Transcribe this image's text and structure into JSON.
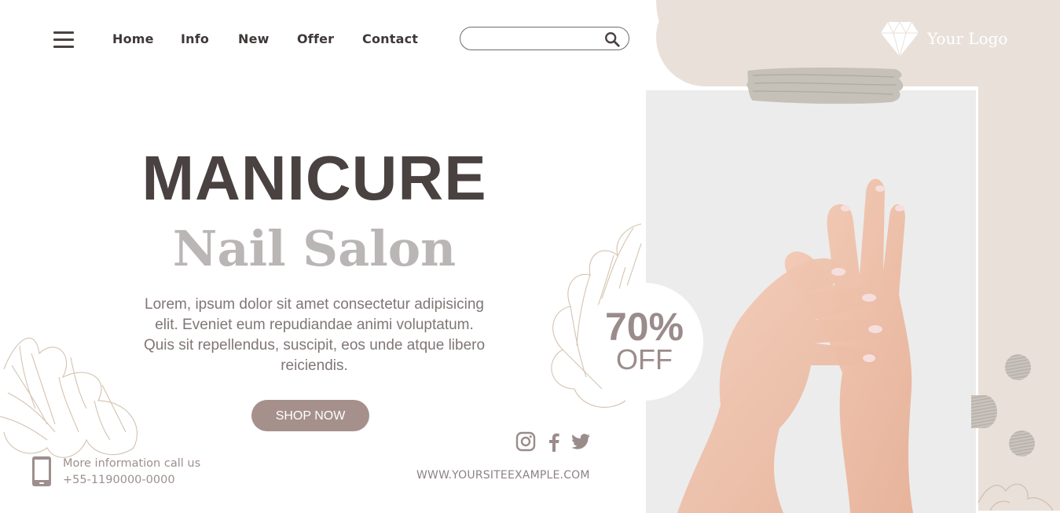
{
  "header": {
    "nav": [
      "Home",
      "Info",
      "New",
      "Offer",
      "Contact"
    ],
    "search": {
      "value": "",
      "placeholder": ""
    },
    "logo_text": "Your Logo"
  },
  "hero": {
    "title": "MANICURE",
    "subtitle": "Nail Salon",
    "body": "Lorem, ipsum dolor sit amet consectetur adipisicing elit. Eveniet eum repudiandae animi voluptatum. Quis sit repellendus, suscipit, eos unde atque libero reiciendis.",
    "cta": "SHOP NOW"
  },
  "contact": {
    "line1": "More information call us",
    "phone": "+55-1190000-0000"
  },
  "offer": {
    "percent": "70%",
    "label": "OFF"
  },
  "social": [
    "instagram-icon",
    "facebook-icon",
    "twitter-icon"
  ],
  "website": "WWW.YOURSITEEXAMPLE.COM",
  "colors": {
    "dark": "#4a4141",
    "muted_subtitle": "#b9b6b5",
    "accent": "#a6908c",
    "beige": "#e9e0da"
  }
}
